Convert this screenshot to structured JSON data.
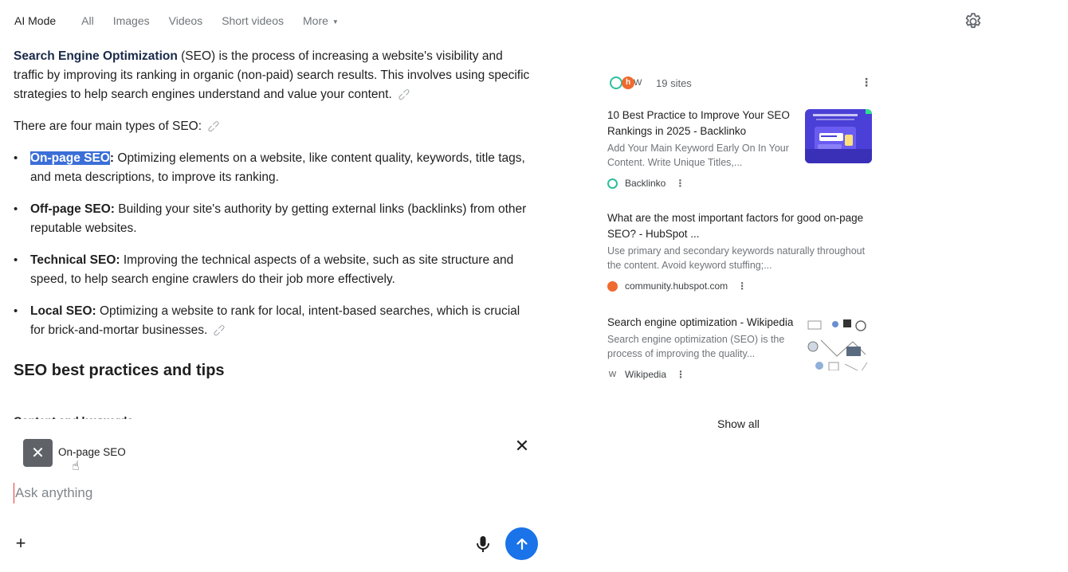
{
  "nav": {
    "tabs": [
      {
        "label": "AI Mode",
        "active": true
      },
      {
        "label": "All"
      },
      {
        "label": "Images"
      },
      {
        "label": "Videos"
      },
      {
        "label": "Short videos"
      }
    ],
    "more_label": "More",
    "settings_icon": "gear-icon"
  },
  "answer": {
    "intro_keyword": "Search Engine Optimization",
    "intro_rest": " (SEO) is the process of increasing a website's visibility and traffic by improving its ranking in organic (non-paid) search results. This involves using specific strategies to help search engines understand and value your content.",
    "types_intro": "There are four main types of SEO:",
    "types": [
      {
        "term": "On-page SEO",
        "colon": ":",
        "desc": " Optimizing elements on a website, like content quality, keywords, title tags, and meta descriptions, to improve its ranking."
      },
      {
        "term": "Off-page SEO:",
        "desc": " Building your site's authority by getting external links (backlinks) from other reputable websites."
      },
      {
        "term": "Technical SEO:",
        "desc": " Improving the technical aspects of a website, such as site structure and speed, to help search engine crawlers do their job more effectively."
      },
      {
        "term": "Local SEO:",
        "desc": " Optimizing a website to rank for local, intent-based searches, which is crucial for brick-and-mortar businesses."
      }
    ],
    "heading": "SEO best practices and tips",
    "subheading_cut": "Content and keywords"
  },
  "sources": {
    "count_label": "19 sites",
    "cards": [
      {
        "title": "10 Best Practice to Improve Your SEO Rankings in 2025 - Backlinko",
        "snippet": "Add Your Main Keyword Early On In Your Content. Write Unique Titles,...",
        "site": "Backlinko"
      },
      {
        "title": "What are the most important factors for good on-page SEO? - HubSpot ...",
        "snippet": "Use primary and secondary keywords naturally throughout the content. Avoid keyword stuffing;...",
        "site": "community.hubspot.com"
      },
      {
        "title": "Search engine optimization - Wikipedia",
        "snippet": "Search engine optimization (SEO) is the process of improving the quality...",
        "site": "Wikipedia"
      }
    ],
    "show_all": "Show all"
  },
  "composer": {
    "chip_label": "On-page SEO",
    "placeholder": "Ask anything"
  },
  "colors": {
    "accent": "#1a73e8",
    "highlight": "#3b6fd8",
    "hubspot": "#ef6a2e",
    "backlinko": "#2fbf9a"
  }
}
